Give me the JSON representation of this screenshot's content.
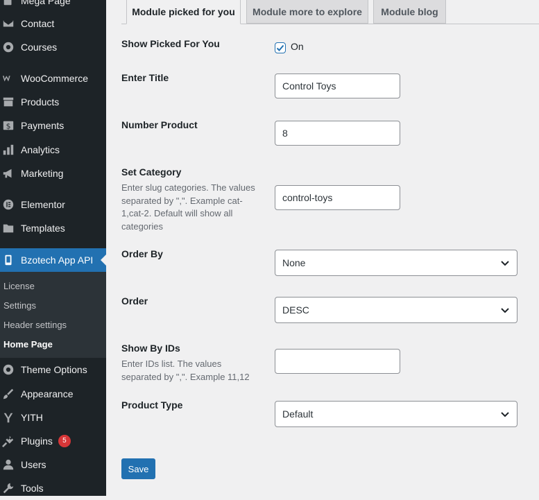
{
  "sidebar": {
    "items": [
      {
        "label": "Mega Page",
        "icon": "pages-icon"
      },
      {
        "label": "Contact",
        "icon": "mail-icon"
      },
      {
        "label": "Courses",
        "icon": "gear-icon"
      },
      {
        "label": "WooCommerce",
        "icon": "woocommerce-icon"
      },
      {
        "label": "Products",
        "icon": "archive-icon"
      },
      {
        "label": "Payments",
        "icon": "dollar-icon"
      },
      {
        "label": "Analytics",
        "icon": "bar-chart-icon"
      },
      {
        "label": "Marketing",
        "icon": "megaphone-icon"
      },
      {
        "label": "Elementor",
        "icon": "elementor-icon"
      },
      {
        "label": "Templates",
        "icon": "folder-icon"
      },
      {
        "label": "Bzotech App API",
        "icon": "mobile-icon"
      },
      {
        "label": "Theme Options",
        "icon": "gear-icon"
      },
      {
        "label": "Appearance",
        "icon": "paintbrush-icon"
      },
      {
        "label": "YITH",
        "icon": "yith-icon"
      },
      {
        "label": "Plugins",
        "icon": "plug-icon",
        "badge": "5"
      },
      {
        "label": "Users",
        "icon": "user-icon"
      },
      {
        "label": "Tools",
        "icon": "wrench-icon"
      }
    ],
    "submenu": [
      {
        "label": "License"
      },
      {
        "label": "Settings"
      },
      {
        "label": "Header settings"
      },
      {
        "label": "Home Page"
      }
    ]
  },
  "tabs": [
    {
      "label": "Module picked for you"
    },
    {
      "label": "Module more to explore"
    },
    {
      "label": "Module blog"
    }
  ],
  "form": {
    "show_picked": {
      "label": "Show Picked For You",
      "checkbox_label": "On",
      "checked": true
    },
    "title": {
      "label": "Enter Title",
      "value": "Control Toys"
    },
    "number": {
      "label": "Number Product",
      "value": "8"
    },
    "category": {
      "label": "Set Category",
      "desc": "Enter slug categories. The values separated by \",\". Example cat-1,cat-2. Default will show all categories",
      "value": "control-toys"
    },
    "order_by": {
      "label": "Order By",
      "value": "None"
    },
    "order": {
      "label": "Order",
      "value": "DESC"
    },
    "ids": {
      "label": "Show By IDs",
      "desc": "Enter IDs list. The values separated by \",\". Example 11,12",
      "value": ""
    },
    "product_type": {
      "label": "Product Type",
      "value": "Default"
    },
    "save_label": "Save"
  },
  "colors": {
    "accent": "#2271b1",
    "sidebar_bg": "#1d2327",
    "badge": "#d63638"
  }
}
